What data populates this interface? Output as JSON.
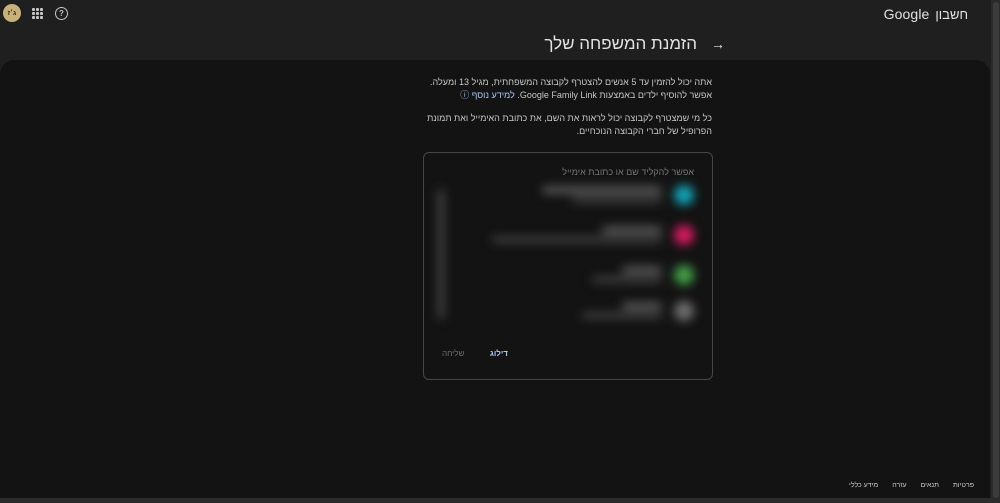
{
  "topbar": {
    "brand_google": "Google",
    "brand_account": "חשבון",
    "avatar_text": "ג׳ז"
  },
  "header": {
    "title": "הזמנת המשפחה שלך"
  },
  "intro": {
    "line1": "אתה יכול להזמין עד 5 אנשים להצטרף לקבוצה המשפחתית, מגיל 13 ומעלה.",
    "line2": "אפשר להוסיף ילדים באמצעות Google Family Link.",
    "learn_more": "למידע נוסף",
    "line3": "כל מי שמצטרף לקבוצה יכול לראות את השם, את כתובת האימייל ואת תמונת הפרופיל של חברי הקבוצה הנוכחיים."
  },
  "card": {
    "search_placeholder": "אפשר להקליד שם או כתובת אימייל",
    "skip_label": "דילוג",
    "send_label": "שליחה",
    "contacts": [
      {
        "color": "#12a4b8"
      },
      {
        "color": "#d81b60"
      },
      {
        "color": "#43a047"
      },
      {
        "color": "#6d6d6d"
      }
    ]
  },
  "footer": {
    "privacy": "פרטיות",
    "terms": "תנאים",
    "help": "עזרה",
    "about": "מידע כללי"
  }
}
